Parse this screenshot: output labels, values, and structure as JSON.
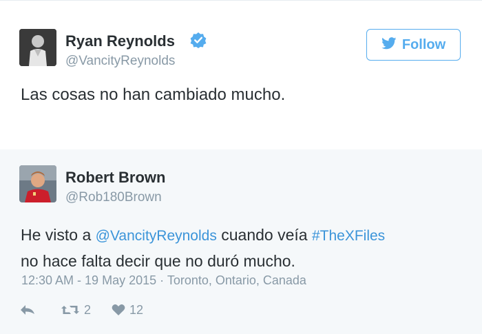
{
  "original_tweet": {
    "author_name": "Ryan Reynolds",
    "author_handle": "@VancityReynolds",
    "follow_label": "Follow",
    "text": "Las cosas no han cambiado mucho.",
    "verified": true
  },
  "reply_tweet": {
    "author_name": "Robert Brown",
    "author_handle": "@Rob180Brown",
    "text_part1": "He visto a ",
    "mention": "@VancityReynolds",
    "text_part2": " cuando veía ",
    "hashtag": "#TheXFiles",
    "text_line2": "no hace falta decir que no duró mucho.",
    "timestamp": "12:30 AM - 19 May 2015",
    "location": "Toronto, Ontario, Canada",
    "retweet_count": "2",
    "like_count": "12"
  },
  "colors": {
    "brand_blue": "#55acee",
    "link_blue": "#3b94d9",
    "text_dark": "#292f33",
    "text_gray": "#8899a6",
    "reply_background": "#f5f8fa"
  },
  "icons": {
    "verified": "verified-badge-icon",
    "follow": "twitter-bird-icon",
    "reply": "reply-arrow-icon",
    "retweet": "retweet-icon",
    "like": "heart-icon"
  }
}
